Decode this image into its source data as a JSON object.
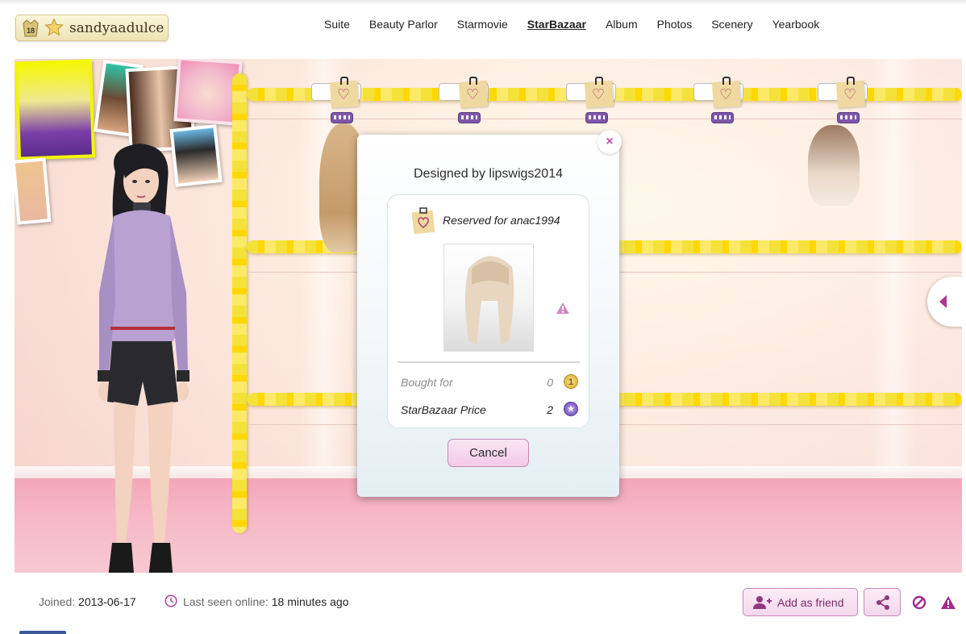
{
  "header": {
    "username": "sandyaadulce",
    "level": "18",
    "nav": [
      {
        "label": "Suite",
        "active": false
      },
      {
        "label": "Beauty Parlor",
        "active": false
      },
      {
        "label": "Starmovie",
        "active": false
      },
      {
        "label": "StarBazaar",
        "active": true
      },
      {
        "label": "Album",
        "active": false
      },
      {
        "label": "Photos",
        "active": false
      },
      {
        "label": "Scenery",
        "active": false
      },
      {
        "label": "Yearbook",
        "active": false
      }
    ]
  },
  "modal": {
    "title": "Designed by lipswigs2014",
    "close_label": "×",
    "reserved_text": "Reserved for anac1994",
    "bought_for_label": "Bought for",
    "bought_for_value": "0",
    "bought_for_currency": "1",
    "price_label": "StarBazaar Price",
    "price_value": "2",
    "price_currency": "★",
    "cancel_label": "Cancel"
  },
  "footer": {
    "joined_label": "Joined:",
    "joined_value": "2013-06-17",
    "last_seen_label": "Last seen online:",
    "last_seen_value": "18 minutes ago",
    "add_friend_label": "Add as friend"
  },
  "colors": {
    "accent": "#c44ea0",
    "rail": "#f4e23a",
    "floor": "#f3a7b8",
    "nav_text": "#222222"
  },
  "icons": [
    "star-icon",
    "level-badge-icon",
    "close-icon",
    "tag-icon",
    "warning-icon",
    "coin-icon",
    "starcoin-icon",
    "clock-icon",
    "add-friend-icon",
    "share-icon",
    "block-icon",
    "report-icon",
    "chevron-left-icon"
  ]
}
